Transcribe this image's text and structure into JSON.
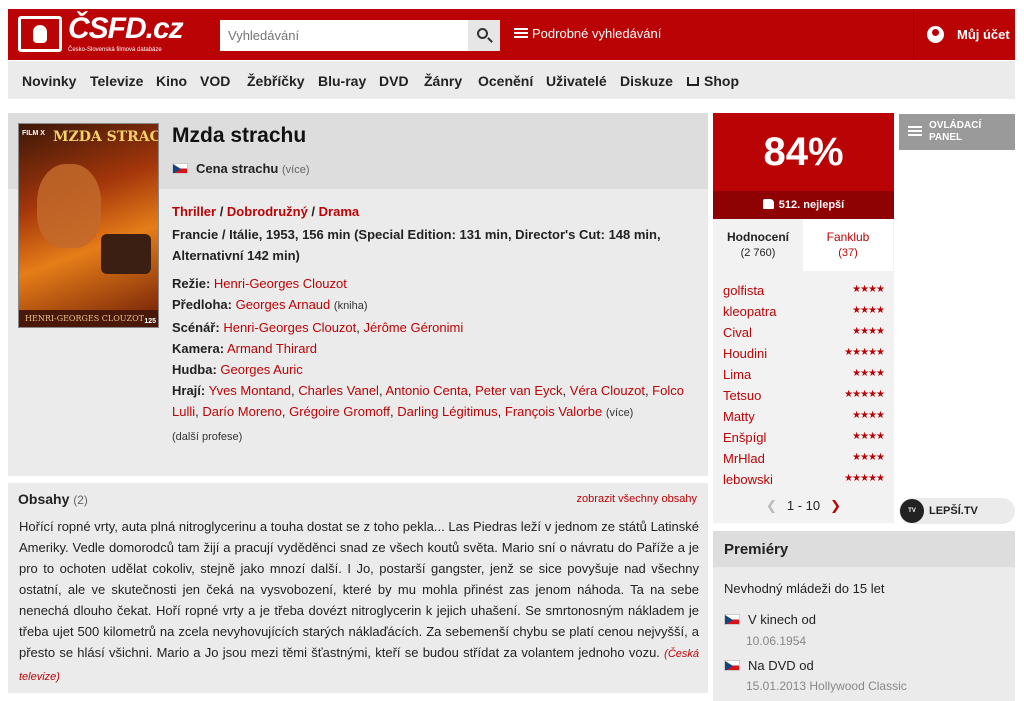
{
  "header": {
    "logo_text": "ČSFD.cz",
    "logo_sub": "Česko-Slovenská filmová databáze",
    "search_placeholder": "Vyhledávání",
    "advanced_search": "Podrobné vyhledávání",
    "account": "Můj účet",
    "brand_color": "#ba0305"
  },
  "nav": [
    "Novinky",
    "Televize",
    "Kino",
    "VOD",
    "Žebříčky",
    "Blu-ray",
    "DVD",
    "Žánry",
    "Ocenění",
    "Uživatelé",
    "Diskuze",
    "Shop"
  ],
  "film": {
    "title": "Mzda strachu",
    "alt_name": "Cena strachu",
    "alt_more": "(více)",
    "genres": [
      "Thriller",
      "Dobrodružný",
      "Drama"
    ],
    "origin": "Francie / Itálie, 1953, 156 min (Special Edition: 131 min, Director's Cut: 148 min, Alternativní 142 min)",
    "poster": {
      "brand": "FILM X",
      "title": "MZDA STRACHU",
      "director": "HENRI-GEORGES CLOUZOT",
      "number": "125"
    },
    "crew": {
      "directing_label": "Režie:",
      "directing": "Henri-Georges Clouzot",
      "source_label": "Předloha:",
      "source": "Georges Arnaud",
      "source_note": "(kniha)",
      "screenplay_label": "Scénář:",
      "screenplay": [
        "Henri-Georges Clouzot",
        "Jérôme Géronimi"
      ],
      "camera_label": "Kamera:",
      "camera": "Armand Thirard",
      "music_label": "Hudba:",
      "music": "Georges Auric",
      "cast_label": "Hrají:",
      "cast": [
        "Yves Montand",
        "Charles Vanel",
        "Antonio Centa",
        "Peter van Eyck",
        "Véra Clouzot",
        "Folco Lulli",
        "Darío Moreno",
        "Grégoire Gromoff",
        "Darling Légitimus",
        "François Valorbe"
      ],
      "cast_more": "(více)",
      "more_professions": "(další profese)"
    }
  },
  "plot": {
    "heading": "Obsahy",
    "count": "(2)",
    "show_all": "zobrazit všechny obsahy",
    "text": "Hořící ropné vrty, auta plná nitroglycerinu a touha dostat se z toho pekla... Las Piedras leží v jednom ze států Latinské Ameriky. Vedle domorodců tam žijí a pracují vyděděnci snad ze všech koutů světa. Mario sní o návratu do Paříže a je pro to ochoten udělat cokoliv, stejně jako mnozí další. I Jo, postarší gangster, jenž se sice povyšuje nad všechny ostatní, ale ve skutečnosti jen čeká na vysvobození, které by mu mohla přinést zas jenom náhoda. Ta na sebe nenechá dlouho čekat. Hoří ropné vrty a je třeba dovézt nitroglycerin k jejich uhašení. Se smrtonosným nákladem je třeba ujet 500 kilometrů na zcela nevyhovujících starých náklaďácích. Za sebemenší chybu se platí cenou nejvyšší, a přesto se hlásí všichni. Mario a Jo jsou mezi těmi šťastnými, kteří se budou střídat za volantem jednoho vozu.",
    "source": "(Česká televize)"
  },
  "rating": {
    "score": "84%",
    "best": "512. nejlepší",
    "tab_ratings": "Hodnocení",
    "tab_ratings_count": "(2 760)",
    "tab_fanclub": "Fanklub",
    "tab_fanclub_count": "(37)",
    "users": [
      {
        "name": "golfista",
        "stars": 4
      },
      {
        "name": "kleopatra",
        "stars": 4
      },
      {
        "name": "Cival",
        "stars": 4
      },
      {
        "name": "Houdini",
        "stars": 5
      },
      {
        "name": "Lima",
        "stars": 4
      },
      {
        "name": "Tetsuo",
        "stars": 5
      },
      {
        "name": "Matty",
        "stars": 4
      },
      {
        "name": "Enšpígl",
        "stars": 4
      },
      {
        "name": "MrHlad",
        "stars": 4
      },
      {
        "name": "lebowski",
        "stars": 5
      }
    ],
    "pager": "1 - 10"
  },
  "side": {
    "panel": "OVLÁDACÍ PANEL",
    "lepsi": "LEPŠÍ.TV"
  },
  "premiery": {
    "heading": "Premiéry",
    "age": "Nevhodný mládeži do 15 let",
    "items": [
      {
        "label": "V kinech od",
        "date": "10.06.1954"
      },
      {
        "label": "Na DVD od",
        "date": "15.01.2013 Hollywood Classic"
      }
    ]
  }
}
